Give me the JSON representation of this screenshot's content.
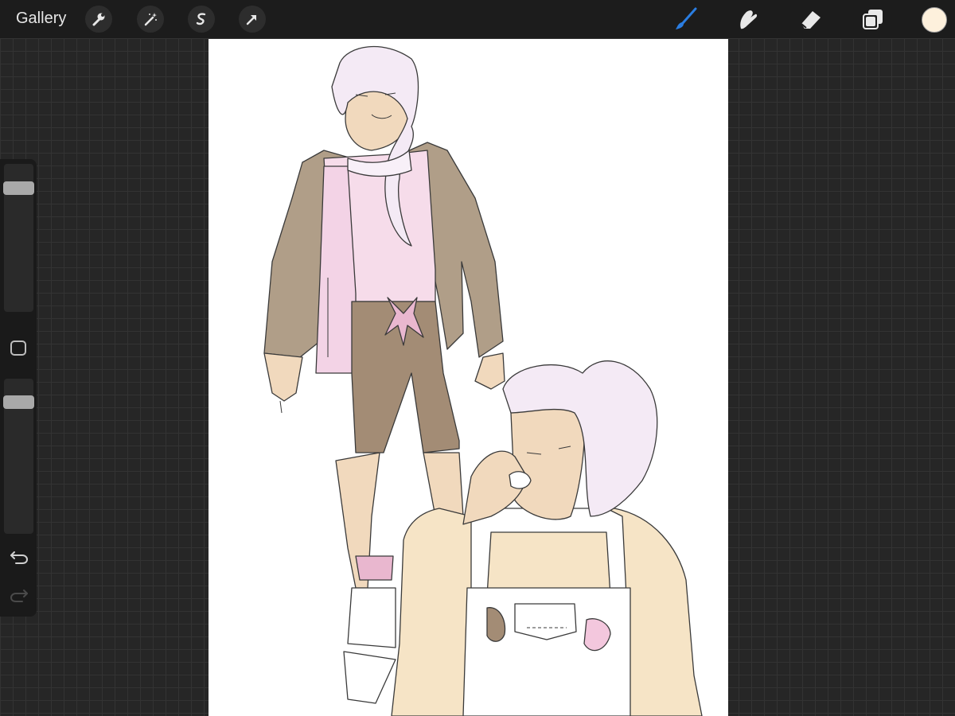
{
  "app": {
    "gallery_label": "Gallery"
  },
  "toolbar_left": [
    {
      "icon": "wrench-icon"
    },
    {
      "icon": "magic-wand-icon"
    },
    {
      "icon": "selection-s-icon"
    },
    {
      "icon": "transform-arrow-icon"
    }
  ],
  "toolbar_right": [
    {
      "icon": "brush-icon",
      "active": true
    },
    {
      "icon": "smudge-icon",
      "active": false
    },
    {
      "icon": "eraser-icon",
      "active": false
    },
    {
      "icon": "layers-icon",
      "active": false
    }
  ],
  "color": {
    "current": "#fdf0dc",
    "active_tool": "#2a7de1"
  },
  "sidebar": {
    "brush_size_level": 0.87,
    "opacity_level": 0.88,
    "undo_icon": "undo-icon",
    "redo_icon": "redo-icon",
    "redo_enabled": false
  },
  "canvas": {
    "content": "sketch-artwork",
    "colors": {
      "skin": "#f1d9bd",
      "jacket": "#b09e88",
      "shorts": "#a38c75",
      "pink": "#f6dcea",
      "hair": "#f4eaf5",
      "bow": "#e9b7cf"
    }
  }
}
